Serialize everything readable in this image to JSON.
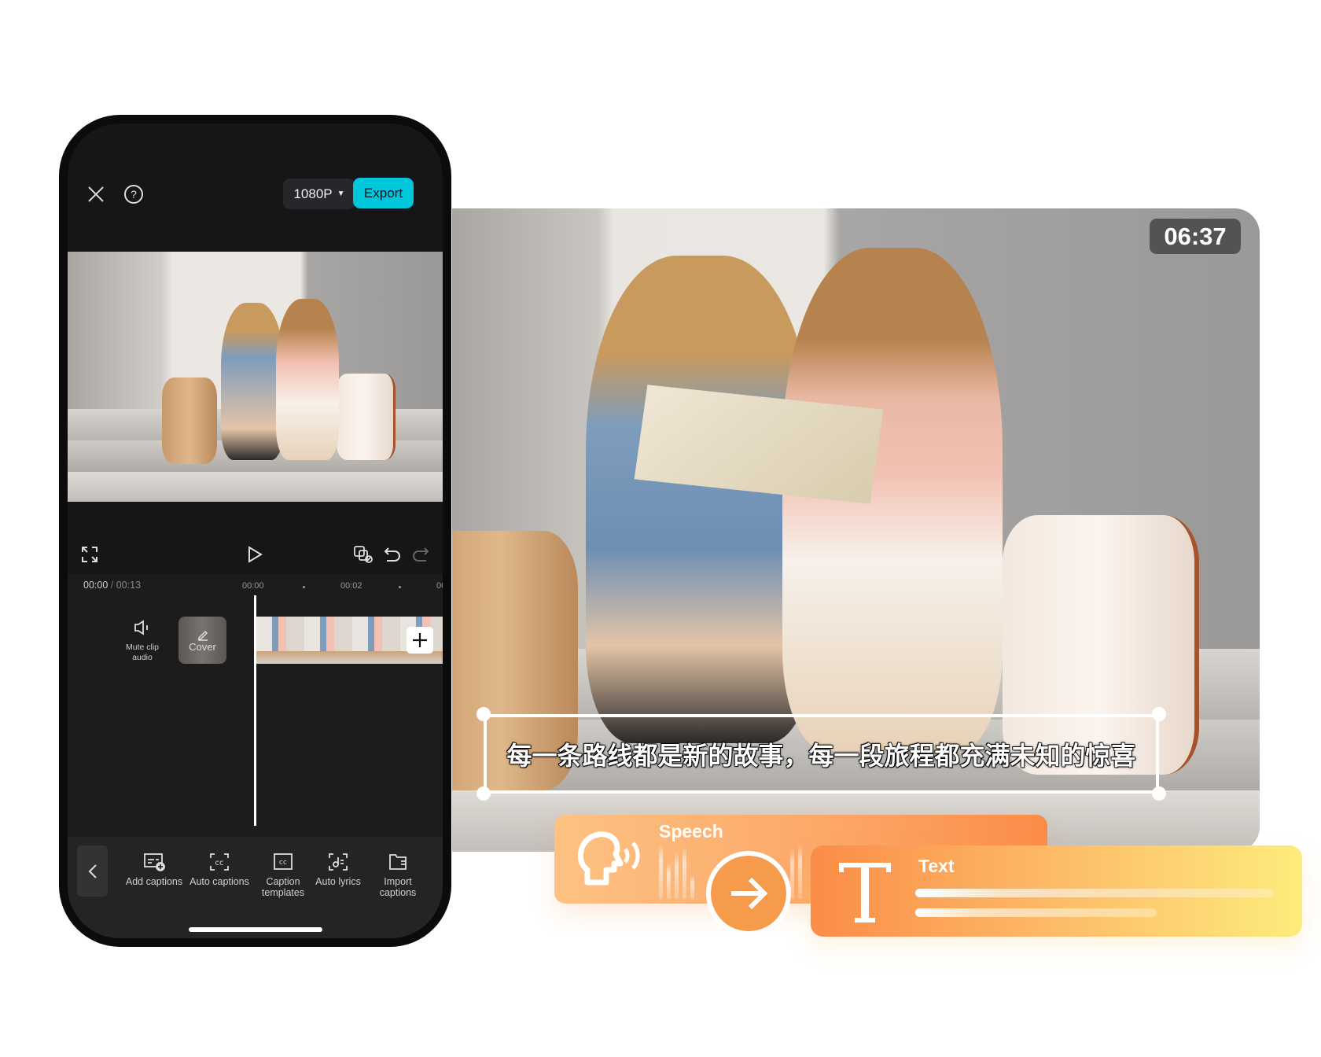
{
  "phone": {
    "resolution_label": "1080P",
    "export_label": "Export",
    "current_time": "00:00",
    "time_separator": "/",
    "total_time": "00:13",
    "ruler": [
      "00:00",
      "00:02",
      "00"
    ],
    "mute_label_line1": "Mute clip",
    "mute_label_line2": "audio",
    "cover_label": "Cover",
    "toolbar": [
      {
        "icon": "add-captions-icon",
        "line1": "Add captions",
        "line2": ""
      },
      {
        "icon": "auto-captions-icon",
        "line1": "Auto captions",
        "line2": ""
      },
      {
        "icon": "caption-templates-icon",
        "line1": "Caption",
        "line2": "templates"
      },
      {
        "icon": "auto-lyrics-icon",
        "line1": "Auto lyrics",
        "line2": ""
      },
      {
        "icon": "import-captions-icon",
        "line1": "Import",
        "line2": "captions"
      }
    ],
    "accent_color": "#00c6dc"
  },
  "video": {
    "timer": "06:37",
    "caption": "每一条路线都是新的故事，每一段旅程都充满未知的惊喜"
  },
  "speech_card": {
    "label": "Speech",
    "colors": [
      "#fdc283",
      "#fb8c48"
    ]
  },
  "text_card": {
    "label": "Text",
    "colors": [
      "#fb8c47",
      "#fdec7c"
    ]
  }
}
